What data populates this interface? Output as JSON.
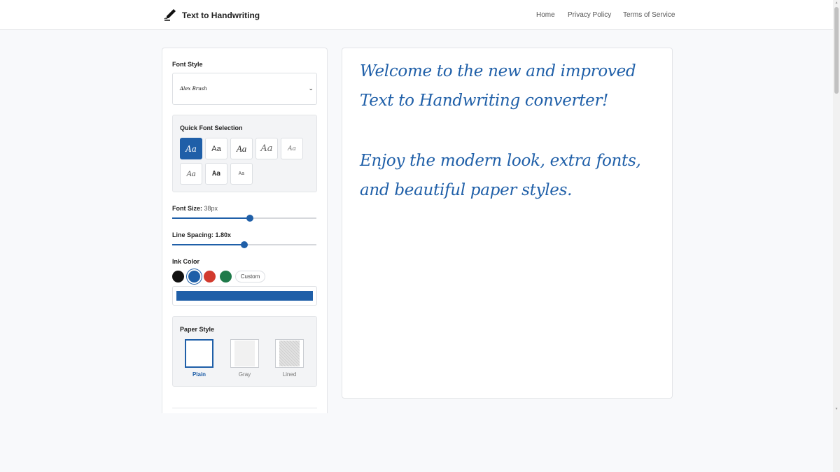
{
  "header": {
    "brand": "Text to Handwriting",
    "logo_icon": "pen-writing-icon",
    "nav": [
      "Home",
      "Privacy Policy",
      "Terms of Service"
    ]
  },
  "controls": {
    "font_style": {
      "label": "Font Style",
      "selected_preview": "Alex Brush",
      "chevron_icon": "chevron-down-icon"
    },
    "quick_font": {
      "label": "Quick Font Selection",
      "fonts": [
        "Aa",
        "Aa",
        "Aa",
        "Aa",
        "Aa",
        "Aa",
        "Aa",
        "Aa"
      ],
      "active_index": 0
    },
    "font_size": {
      "label": "Font Size:",
      "value": "38px",
      "fraction": 0.54
    },
    "line_spacing": {
      "label": "Line Spacing: 1.80x",
      "fraction": 0.5
    },
    "ink_color": {
      "label": "Ink Color",
      "swatches": [
        "#111111",
        "#1f5fa8",
        "#d23a2e",
        "#1f7a4a"
      ],
      "selected": "#1f5fa8",
      "custom_label": "Custom",
      "current": "#1f5fa8"
    },
    "paper_style": {
      "label": "Paper Style",
      "options": [
        "Plain",
        "Gray",
        "Lined"
      ],
      "active": "Plain"
    }
  },
  "preview": {
    "lines": [
      "Welcome to the new and improved",
      "Text to Handwriting converter!",
      "Enjoy the modern look, extra fonts,",
      "and beautiful paper styles."
    ]
  }
}
